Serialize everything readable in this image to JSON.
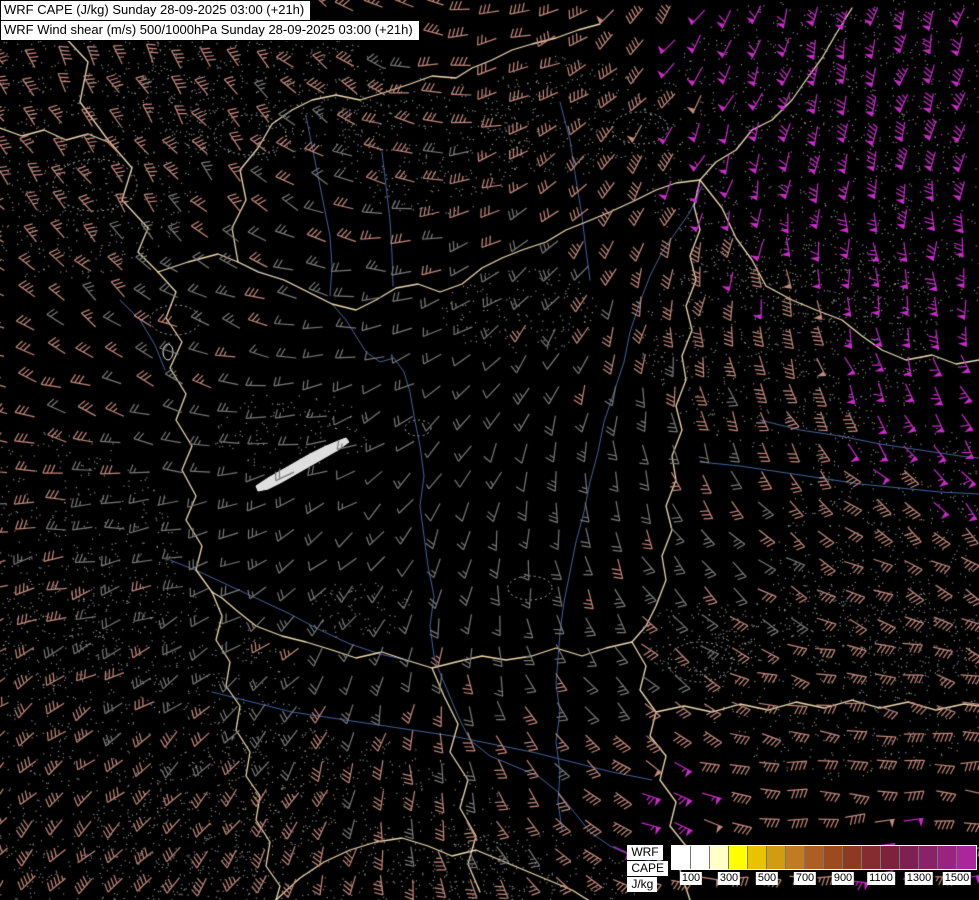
{
  "header": {
    "line1": "WRF CAPE (J/kg) Sunday 28-09-2025 03:00 (+21h)",
    "line2": "WRF Wind shear (m/s) 500/1000hPa Sunday 28-09-2025 03:00 (+21h)"
  },
  "legend": {
    "model_label": "WRF",
    "param_label": "CAPE",
    "unit_label": "J/kg",
    "tick_labels": [
      "100",
      "300",
      "500",
      "700",
      "900",
      "1100",
      "1300",
      "1500"
    ],
    "swatch_colors": [
      "#ffffff",
      "#ffffff",
      "#ffffc8",
      "#ffff00",
      "#e8c400",
      "#d09c10",
      "#c07c20",
      "#ae5e22",
      "#9c4a20",
      "#8c3a22",
      "#842c2e",
      "#7c223c",
      "#7e2052",
      "#8a2268",
      "#982480",
      "#aa269a"
    ]
  },
  "map": {
    "background_color": "#000000",
    "border_color": "#ecd9ae",
    "river_color": "#4a6fb0",
    "lake_fill_color": "#dedede",
    "lake_outline_color": "#f0f0f0",
    "stipple_color": "#8f8f8f",
    "contour_color": "#a8a8a8",
    "barb_low_color": "#7a7a7a",
    "barb_mid_color": "#c48a7e",
    "barb_high_color": "#cd2acd"
  }
}
